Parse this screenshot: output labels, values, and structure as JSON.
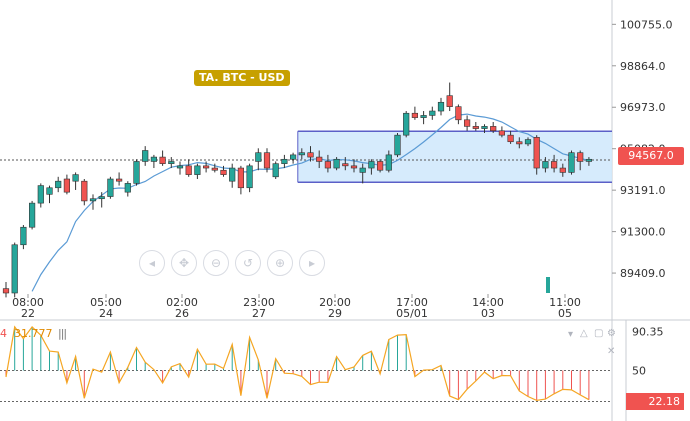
{
  "symbol_label": "TA.  BTC - USD",
  "current_price": "94567.0",
  "indicator": {
    "left_clip": "4",
    "value_text": "31.777",
    "marker": "|||",
    "current_value": "22.18"
  },
  "osc_controls": [
    "chevron-down-icon",
    "triangle-up-icon",
    "square-icon",
    "gear-icon",
    "close-icon"
  ],
  "toolbar_icons": [
    "arrow-left-icon",
    "pan-icon",
    "zoom-out-icon",
    "reset-icon",
    "zoom-in-icon",
    "arrow-right-icon"
  ],
  "colors": {
    "bull": "#26a69a",
    "bear": "#ef5350",
    "ma_line": "#5b9bd5",
    "box_fill": "#cfe8fb",
    "box_border": "#5b5fc7",
    "osc_line": "#f5a623",
    "price_tag": "#f05350",
    "label": "#c7a000"
  },
  "chart_data": {
    "type": "candlestick",
    "y_ticks": [
      "100755.0",
      "98864.0",
      "96973.0",
      "95082.0",
      "93191.0",
      "91300.0",
      "89409.0"
    ],
    "ylim": [
      88500,
      101500
    ],
    "x_ticks": [
      {
        "time": "08:00",
        "date": "22"
      },
      {
        "time": "05:00",
        "date": "24"
      },
      {
        "time": "02:00",
        "date": "26"
      },
      {
        "time": "23:00",
        "date": "27"
      },
      {
        "time": "20:00",
        "date": "29"
      },
      {
        "time": "17:00",
        "date": "05/01"
      },
      {
        "time": "14:00",
        "date": "03"
      },
      {
        "time": "11:00",
        "date": "05"
      }
    ],
    "candles": [
      [
        88700,
        89000,
        88300,
        88500
      ],
      [
        88500,
        90800,
        88300,
        90700
      ],
      [
        90700,
        91600,
        90500,
        91500
      ],
      [
        91500,
        92700,
        91400,
        92600
      ],
      [
        92600,
        93500,
        92400,
        93400
      ],
      [
        93000,
        93400,
        92600,
        93300
      ],
      [
        93300,
        93800,
        93100,
        93600
      ],
      [
        93700,
        93900,
        93000,
        93100
      ],
      [
        93600,
        94000,
        93200,
        93900
      ],
      [
        93600,
        93700,
        92500,
        92700
      ],
      [
        92700,
        93000,
        92300,
        92800
      ],
      [
        92800,
        93100,
        92400,
        92900
      ],
      [
        92900,
        93800,
        92800,
        93700
      ],
      [
        93700,
        94000,
        93400,
        93600
      ],
      [
        93100,
        93600,
        92900,
        93500
      ],
      [
        93500,
        94600,
        93400,
        94500
      ],
      [
        94500,
        95200,
        94300,
        95000
      ],
      [
        94500,
        94800,
        94200,
        94700
      ],
      [
        94700,
        95000,
        94300,
        94400
      ],
      [
        94400,
        94700,
        94200,
        94500
      ],
      [
        94200,
        94500,
        93900,
        94300
      ],
      [
        94300,
        94600,
        93800,
        93900
      ],
      [
        93900,
        94400,
        93700,
        94300
      ],
      [
        94300,
        94500,
        94000,
        94200
      ],
      [
        94200,
        94400,
        94000,
        94100
      ],
      [
        94100,
        94300,
        93800,
        93900
      ],
      [
        93600,
        94400,
        93300,
        94200
      ],
      [
        94200,
        94300,
        93000,
        93300
      ],
      [
        93300,
        94400,
        93100,
        94300
      ],
      [
        94500,
        95100,
        94100,
        94900
      ],
      [
        94900,
        95100,
        94000,
        94200
      ],
      [
        93800,
        94500,
        93700,
        94400
      ],
      [
        94400,
        94800,
        94200,
        94600
      ],
      [
        94600,
        94900,
        94400,
        94800
      ],
      [
        94800,
        95100,
        94600,
        94900
      ],
      [
        94900,
        95200,
        94500,
        94700
      ],
      [
        94700,
        95000,
        94200,
        94500
      ],
      [
        94500,
        94800,
        94000,
        94200
      ],
      [
        94200,
        94700,
        94100,
        94600
      ],
      [
        94400,
        94700,
        94100,
        94300
      ],
      [
        94300,
        94600,
        94000,
        94200
      ],
      [
        94000,
        94400,
        93500,
        94200
      ],
      [
        94200,
        94600,
        93900,
        94500
      ],
      [
        94500,
        94600,
        94000,
        94100
      ],
      [
        94100,
        95000,
        94000,
        94800
      ],
      [
        94800,
        95800,
        94700,
        95700
      ],
      [
        95700,
        96800,
        95600,
        96700
      ],
      [
        96700,
        97000,
        96400,
        96500
      ],
      [
        96500,
        96800,
        96200,
        96600
      ],
      [
        96600,
        97000,
        96400,
        96800
      ],
      [
        96800,
        97400,
        96600,
        97200
      ],
      [
        97500,
        98100,
        96800,
        97000
      ],
      [
        97000,
        97100,
        96200,
        96400
      ],
      [
        96400,
        96600,
        95900,
        96100
      ],
      [
        96100,
        96300,
        95900,
        96000
      ],
      [
        96000,
        96200,
        95800,
        96100
      ],
      [
        96100,
        96300,
        95800,
        95900
      ],
      [
        95900,
        96100,
        95600,
        95700
      ],
      [
        95700,
        95900,
        95300,
        95400
      ],
      [
        95400,
        95600,
        95100,
        95300
      ],
      [
        95300,
        95600,
        95200,
        95500
      ],
      [
        95600,
        95700,
        93900,
        94200
      ],
      [
        94200,
        94700,
        94000,
        94500
      ],
      [
        94500,
        94800,
        94000,
        94200
      ],
      [
        94200,
        94400,
        93800,
        94000
      ],
      [
        94000,
        95000,
        93900,
        94900
      ],
      [
        94900,
        95000,
        94100,
        94500
      ],
      [
        94500,
        94700,
        94300,
        94600
      ]
    ],
    "range_box": {
      "top_price": 95880,
      "bottom_price": 93550,
      "start_index": 34,
      "end_index": 69
    },
    "oscillator": {
      "levels": [
        "90.35",
        "50"
      ],
      "current": 22.18
    }
  }
}
